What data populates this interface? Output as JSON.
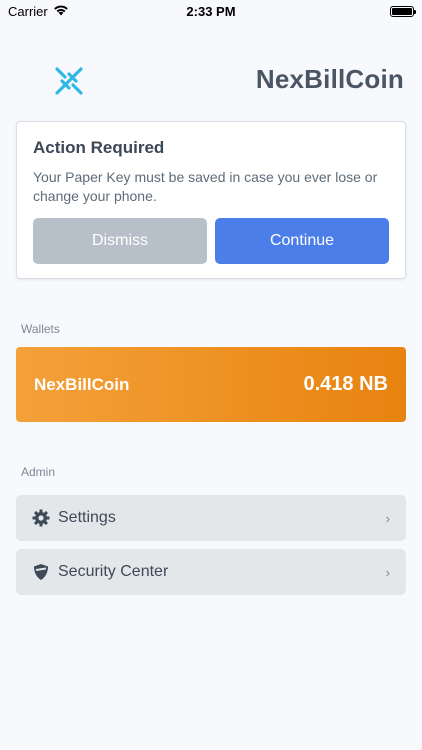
{
  "status_bar": {
    "carrier": "Carrier",
    "time": "2:33 PM"
  },
  "header": {
    "title": "NexBillCoin",
    "logo_icon": "x-logo-icon"
  },
  "prompt": {
    "title": "Action Required",
    "body": "Your Paper Key must be saved in case you ever lose or change your phone.",
    "dismiss_label": "Dismiss",
    "continue_label": "Continue"
  },
  "wallets": {
    "section_label": "Wallets",
    "items": [
      {
        "name": "NexBillCoin",
        "balance": "0.418 NB"
      }
    ]
  },
  "admin": {
    "section_label": "Admin",
    "items": [
      {
        "label": "Settings",
        "icon": "gear-icon"
      },
      {
        "label": "Security Center",
        "icon": "shield-icon"
      }
    ]
  },
  "colors": {
    "accent": "#4b7ee8",
    "wallet_start": "#f4a13a",
    "wallet_end": "#e8830f",
    "logo": "#2fb8e6"
  }
}
